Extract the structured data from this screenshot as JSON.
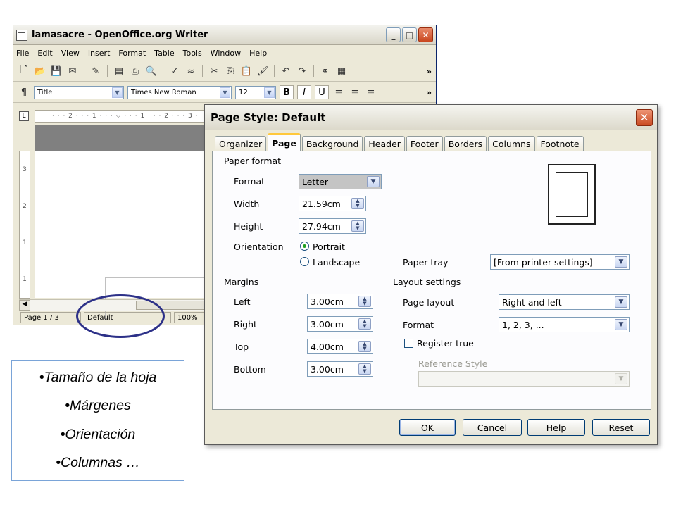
{
  "writer": {
    "title": "lamasacre - OpenOffice.org Writer",
    "menu": [
      "File",
      "Edit",
      "View",
      "Insert",
      "Format",
      "Table",
      "Tools",
      "Window",
      "Help"
    ],
    "toolbar_more": "»",
    "style_value": "Title",
    "font_value": "Times New Roman",
    "size_value": "12",
    "bold_label": "B",
    "italic_label": "I",
    "underline_label": "U",
    "ruler_text": "· · · 2 · · · 1 · · · ⌵ · · · 1 · · · 2 · · · 3 ·",
    "ruler_corner": "L",
    "vruler_marks": [
      "3",
      "2",
      "1",
      "1"
    ],
    "status": {
      "page": "Page 1 / 3",
      "style": "Default",
      "zoom": "100%"
    }
  },
  "dialog": {
    "title": "Page Style: Default",
    "tabs": [
      "Organizer",
      "Page",
      "Background",
      "Header",
      "Footer",
      "Borders",
      "Columns",
      "Footnote"
    ],
    "paper_format": {
      "section": "Paper format",
      "format_label": "Format",
      "format_value": "Letter",
      "width_label": "Width",
      "width_value": "21.59cm",
      "height_label": "Height",
      "height_value": "27.94cm",
      "orientation_label": "Orientation",
      "portrait_label": "Portrait",
      "landscape_label": "Landscape",
      "orientation_selected": "Portrait",
      "paper_tray_label": "Paper tray",
      "paper_tray_value": "[From printer settings]"
    },
    "margins": {
      "section": "Margins",
      "left_label": "Left",
      "left_value": "3.00cm",
      "right_label": "Right",
      "right_value": "3.00cm",
      "top_label": "Top",
      "top_value": "4.00cm",
      "bottom_label": "Bottom",
      "bottom_value": "3.00cm"
    },
    "layout": {
      "section": "Layout settings",
      "page_layout_label": "Page layout",
      "page_layout_value": "Right and left",
      "format_label": "Format",
      "format_value": "1, 2, 3, ...",
      "register_true_label": "Register-true",
      "register_true_checked": false,
      "reference_style_label": "Reference Style",
      "reference_style_value": ""
    },
    "buttons": {
      "ok": "OK",
      "cancel": "Cancel",
      "help": "Help",
      "reset": "Reset"
    }
  },
  "notes": [
    "•Tamaño de la hoja",
    "•Márgenes",
    "•Orientación",
    "•Columnas …"
  ],
  "colors": {
    "highlight_ellipse": "#2d3188",
    "note_border": "#7aa4d8",
    "active_tab_accent": "#ffc83c"
  }
}
